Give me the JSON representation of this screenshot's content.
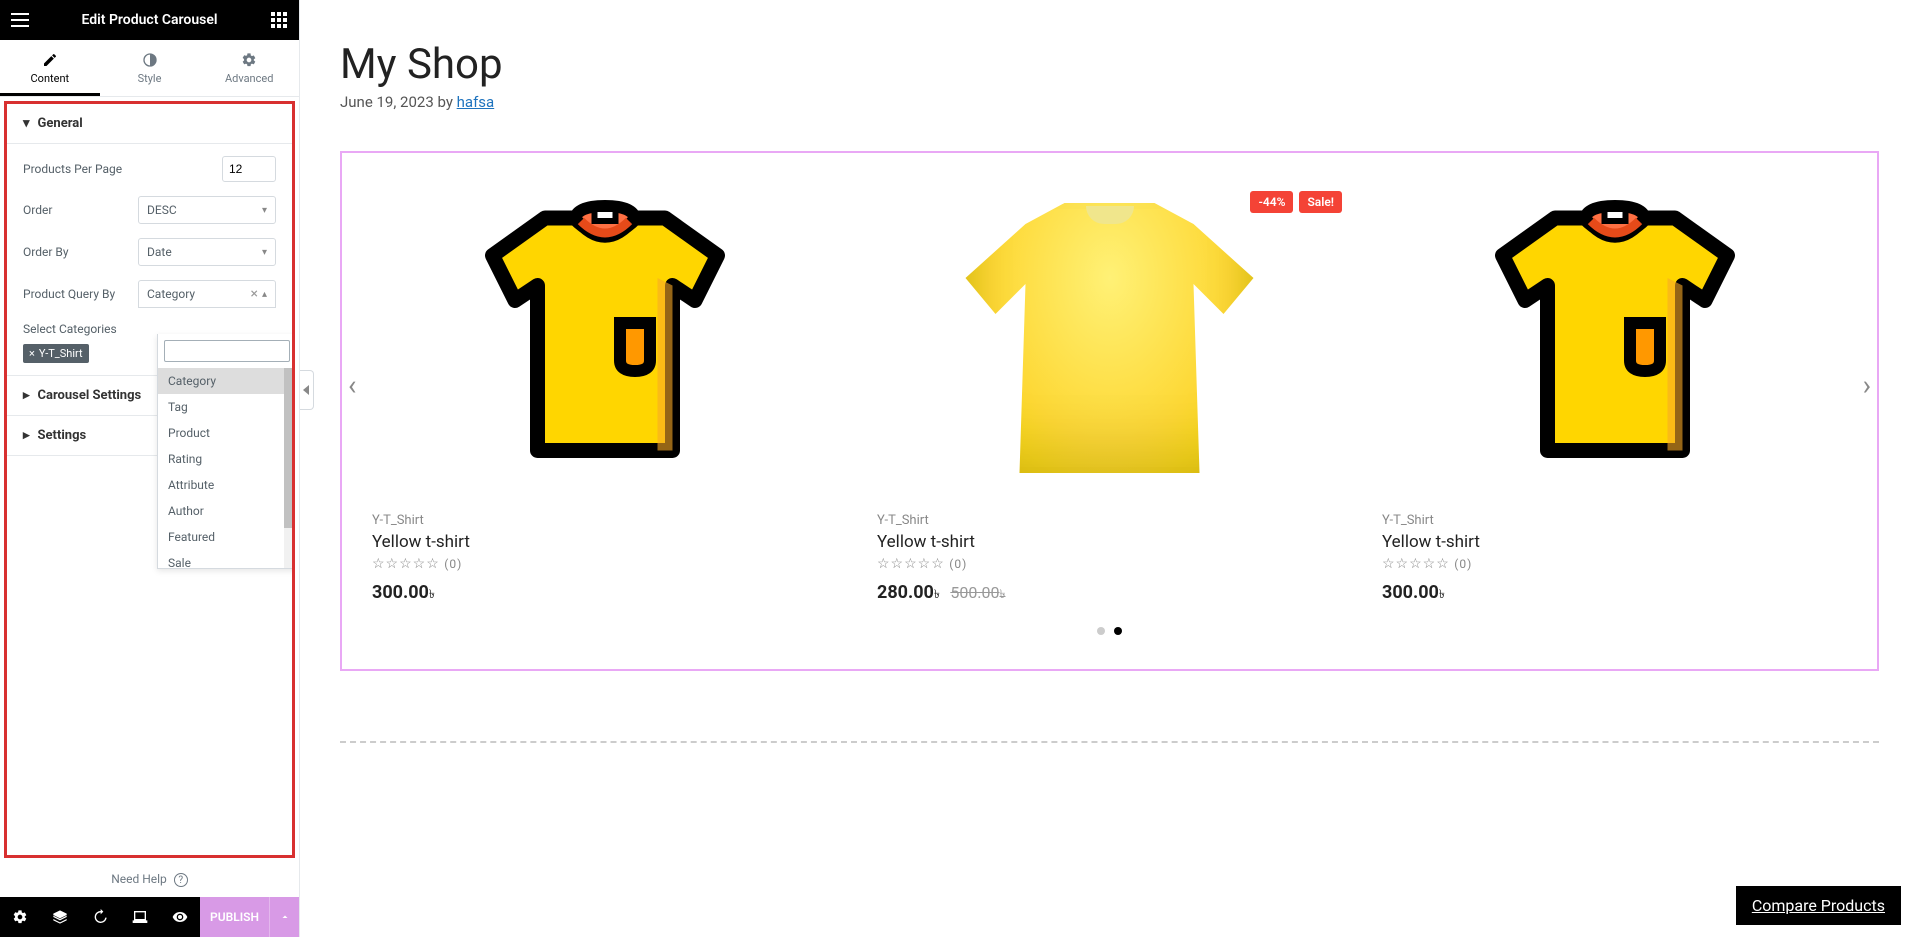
{
  "sidebar": {
    "title": "Edit Product Carousel",
    "tabs": {
      "content": "Content",
      "style": "Style",
      "advanced": "Advanced"
    },
    "sections": {
      "general": {
        "title": "General",
        "products_per_page_label": "Products Per Page",
        "products_per_page_value": "12",
        "order_label": "Order",
        "order_value": "DESC",
        "order_by_label": "Order By",
        "order_by_value": "Date",
        "product_query_by_label": "Product Query By",
        "product_query_by_value": "Category",
        "select_categories_label": "Select Categories",
        "selected_category_chip": "Y-T_Shirt"
      },
      "carousel_settings": {
        "title": "Carousel Settings"
      },
      "settings": {
        "title": "Settings"
      }
    },
    "dropdown_options": [
      "Category",
      "Tag",
      "Product",
      "Rating",
      "Attribute",
      "Author",
      "Featured",
      "Sale"
    ],
    "help_label": "Need Help",
    "footer": {
      "publish": "PUBLISH"
    }
  },
  "page": {
    "title": "My Shop",
    "date": "June 19, 2023",
    "byline_prefix": " by ",
    "author": "hafsa"
  },
  "products": [
    {
      "category": "Y-T_Shirt",
      "name": "Yellow t-shirt",
      "rating_count": "(0)",
      "price": "300.00",
      "currency": "৳",
      "badge_percent": "",
      "badge_sale": "",
      "old_price": "",
      "img": "icon"
    },
    {
      "category": "Y-T_Shirt",
      "name": "Yellow t-shirt",
      "rating_count": "(0)",
      "price": "280.00",
      "currency": "৳",
      "badge_percent": "-44%",
      "badge_sale": "Sale!",
      "old_price": "500.00",
      "img": "real"
    },
    {
      "category": "Y-T_Shirt",
      "name": "Yellow t-shirt",
      "rating_count": "(0)",
      "price": "300.00",
      "currency": "৳",
      "badge_percent": "",
      "badge_sale": "",
      "old_price": "",
      "img": "icon"
    }
  ],
  "compare": "Compare Products"
}
